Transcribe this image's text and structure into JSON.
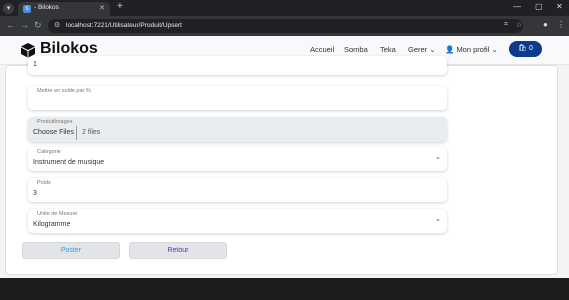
{
  "browser": {
    "tab_title": "- Bilokos",
    "tab_favicon": "S",
    "url": "localhost:7221/Utilisateur/Produit/Upsert"
  },
  "navbar": {
    "brand": "Bilokos",
    "links": [
      "Accueil",
      "Somba",
      "Teka",
      "Gerer",
      "Mon profil"
    ],
    "cart_count": "0"
  },
  "form": {
    "top_value": "1",
    "solde": {
      "label": "Mettre en solde par %",
      "value": ""
    },
    "images": {
      "label": "ProduitImages",
      "button": "Choose Files",
      "status": "2 files"
    },
    "categorie": {
      "label": "Categorie",
      "value": "Instrument de musique"
    },
    "poids": {
      "label": "Poids",
      "value": "3"
    },
    "unite": {
      "label": "Unite de Mesure",
      "value": "Kilogramme"
    },
    "poster": "Poster",
    "retour": "Retour"
  },
  "colors": {
    "brand_blue": "#0d3a8a",
    "poster_text": "#1ba9e0",
    "retour_text": "#4a3acc"
  }
}
